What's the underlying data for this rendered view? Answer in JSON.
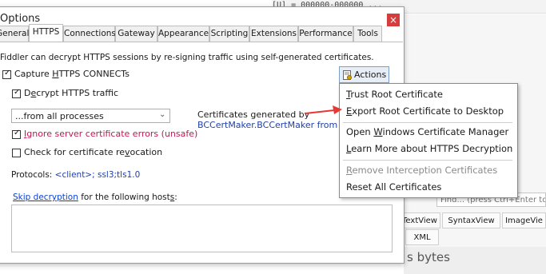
{
  "background": {
    "top_text": "[U] = 000000-000000 ...",
    "find_placeholder": "Find... (press Ctrl+Enter to",
    "tabs": [
      "TextView",
      "SyntaxView",
      "ImageVie"
    ],
    "xml_tab": "XML",
    "bytes_label": "s bytes"
  },
  "dialog": {
    "title": "Options",
    "close_glyph": "×",
    "tabs": [
      "General",
      "HTTPS",
      "Connections",
      "Gateway",
      "Appearance",
      "Scripting",
      "Extensions",
      "Performance",
      "Tools"
    ],
    "active_tab": "HTTPS",
    "intro": "Fiddler can decrypt HTTPS sessions by re-signing traffic using self-generated certificates.",
    "capture": {
      "pre": "Capture ",
      "u": "H",
      "post": "TTPS CONNECTs",
      "checked": true
    },
    "decrypt": {
      "pre": "D",
      "u": "e",
      "post": "crypt HTTPS traffic",
      "checked": true
    },
    "process_select": "...from all processes",
    "ignore_errors": {
      "u": "I",
      "post": "gnore server certificate errors (unsafe)",
      "checked": true
    },
    "revocation": {
      "pre": "Check for certificate re",
      "u": "v",
      "post": "ocation",
      "checked": false
    },
    "certs_generated_label": "Certificates generated by",
    "certs_generated_value": "BCCertMaker.BCCertMaker from Cert",
    "protocols_label": "Protocols: ",
    "protocols_value": "<client>; ssl3;tls1.0",
    "skip_link": "Skip decryption",
    "skip_post": " for the following host",
    "skip_u": "s",
    "skip_colon": ":",
    "actions_button": "Actions",
    "accent": "#0a3fd6",
    "error_color": "#c0174f"
  },
  "actions_menu": {
    "items": [
      {
        "u": "T",
        "post": "rust Root Certificate",
        "enabled": true
      },
      {
        "u": "E",
        "post": "xport Root Certificate to Desktop",
        "enabled": true
      },
      {
        "pre": "Open ",
        "u": "W",
        "post": "indows Certificate Manager",
        "enabled": true
      },
      {
        "u": "L",
        "post": "earn More about HTTPS Decryption",
        "enabled": true
      },
      {
        "u": "R",
        "post": "emove Interception Certificates",
        "enabled": false
      },
      {
        "pre": "Reset All Certificates",
        "enabled": true
      }
    ],
    "annotation_color": "#e53935"
  }
}
